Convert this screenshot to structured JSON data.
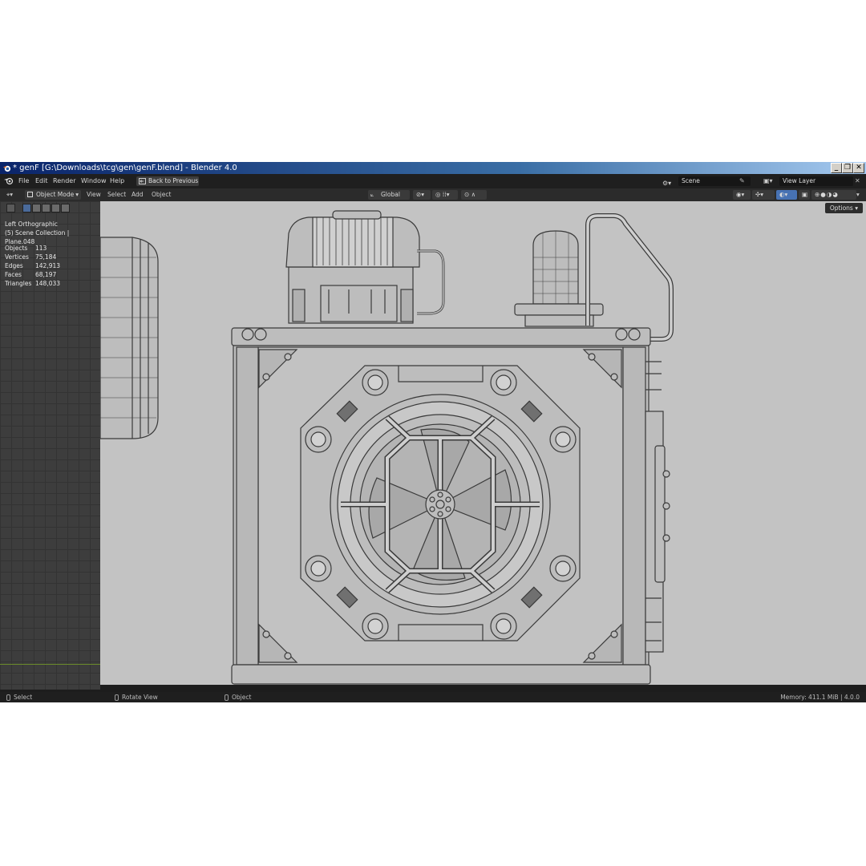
{
  "window": {
    "title": "* genF [G:\\Downloads\\tcg\\gen\\genF.blend] - Blender 4.0",
    "controls": [
      "_",
      "❐",
      "✕"
    ]
  },
  "menubar": {
    "items": [
      "File",
      "Edit",
      "Render",
      "Window",
      "Help"
    ],
    "back_button": "Back to Previous",
    "scene_field": "Scene",
    "view_layer_field": "View Layer"
  },
  "viewport_header": {
    "mode": "Object Mode",
    "menus": [
      "View",
      "Select",
      "Add",
      "Object"
    ],
    "transform_orientation": "Global",
    "options_button": "Options"
  },
  "overlay": {
    "view_name": "Left Orthographic",
    "collection": "(5) Scene Collection | Plane.048"
  },
  "stats": [
    {
      "label": "Objects",
      "value": "113"
    },
    {
      "label": "Vertices",
      "value": "75,184"
    },
    {
      "label": "Edges",
      "value": "142,913"
    },
    {
      "label": "Faces",
      "value": "68,197"
    },
    {
      "label": "Triangles",
      "value": "148,033"
    }
  ],
  "statusbar": {
    "select": "Select",
    "rotate": "Rotate View",
    "object": "Object",
    "memory": "Memory: 411.1 MiB | 4.0.0"
  },
  "colors": {
    "viewport_bg": "#c3c3c3",
    "model_fill": "#bfbfbf",
    "model_stroke": "#3a3a3a",
    "panel_bg": "#3d3d3d"
  }
}
